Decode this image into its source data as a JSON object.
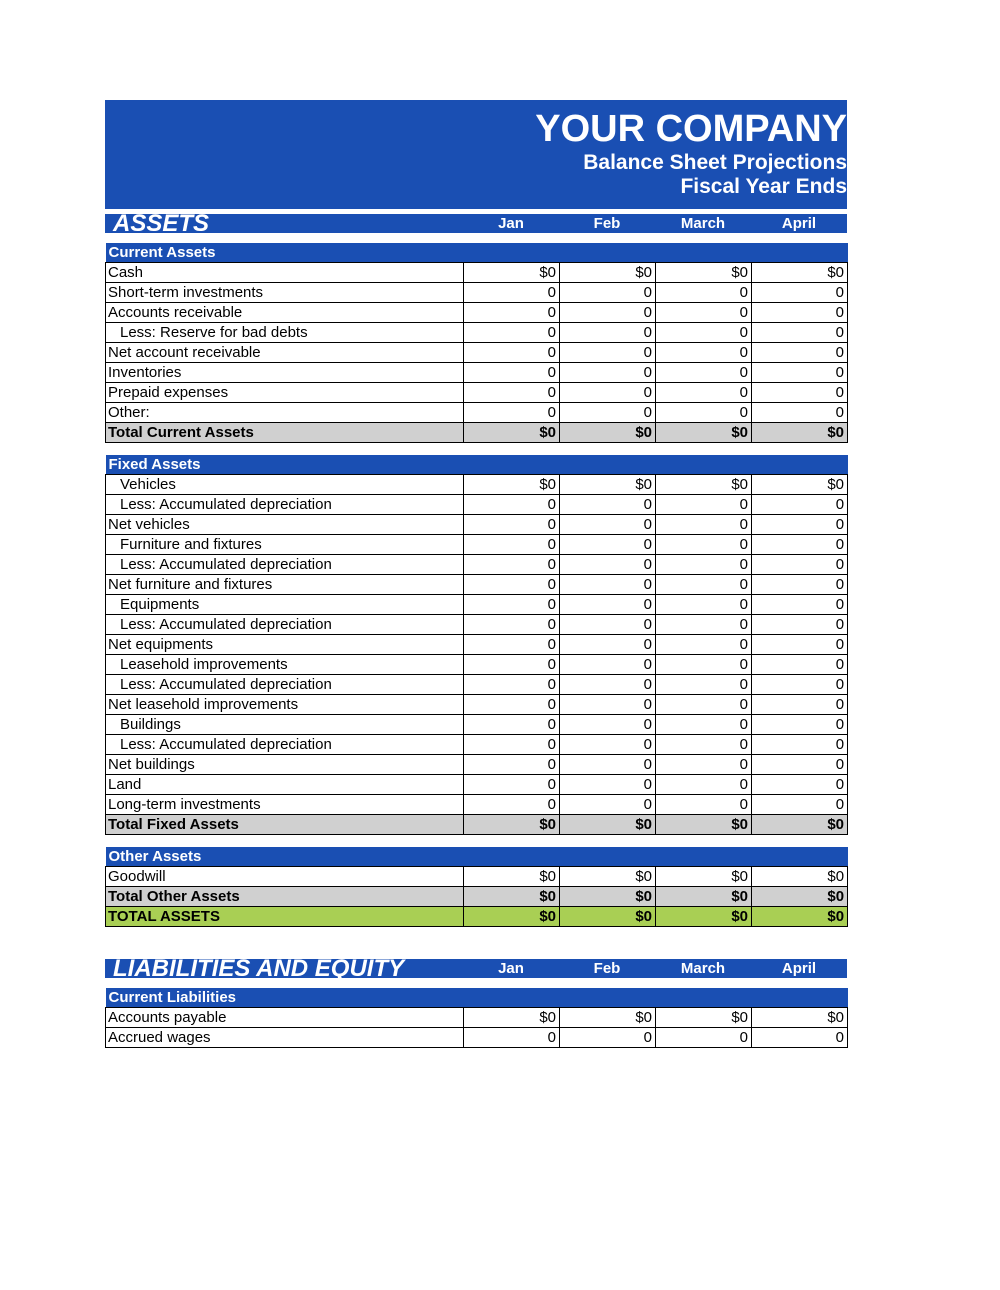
{
  "header": {
    "company": "YOUR COMPANY",
    "line1": "Balance Sheet Projections",
    "line2": "Fiscal Year Ends"
  },
  "months": [
    "Jan",
    "Feb",
    "March",
    "April"
  ],
  "assets": {
    "title": "ASSETS",
    "current": {
      "title": "Current Assets",
      "rows": [
        {
          "label": "Cash",
          "indent": 0,
          "v": [
            "$0",
            "$0",
            "$0",
            "$0"
          ]
        },
        {
          "label": "Short-term investments",
          "indent": 0,
          "v": [
            "0",
            "0",
            "0",
            "0"
          ]
        },
        {
          "label": "Accounts receivable",
          "indent": 0,
          "v": [
            "0",
            "0",
            "0",
            "0"
          ]
        },
        {
          "label": "Less: Reserve for bad debts",
          "indent": 1,
          "v": [
            "0",
            "0",
            "0",
            "0"
          ]
        },
        {
          "label": "Net account receivable",
          "indent": 0,
          "v": [
            "0",
            "0",
            "0",
            "0"
          ]
        },
        {
          "label": "Inventories",
          "indent": 0,
          "v": [
            "0",
            "0",
            "0",
            "0"
          ]
        },
        {
          "label": "Prepaid expenses",
          "indent": 0,
          "v": [
            "0",
            "0",
            "0",
            "0"
          ]
        },
        {
          "label": "Other:",
          "indent": 0,
          "v": [
            "0",
            "0",
            "0",
            "0"
          ],
          "lastopen": true
        }
      ],
      "total": {
        "label": "Total Current Assets",
        "v": [
          "$0",
          "$0",
          "$0",
          "$0"
        ]
      }
    },
    "fixed": {
      "title": "Fixed Assets",
      "rows": [
        {
          "label": "Vehicles",
          "indent": 1,
          "v": [
            "$0",
            "$0",
            "$0",
            "$0"
          ]
        },
        {
          "label": "Less: Accumulated depreciation",
          "indent": 1,
          "v": [
            "0",
            "0",
            "0",
            "0"
          ]
        },
        {
          "label": "Net vehicles",
          "indent": 0,
          "v": [
            "0",
            "0",
            "0",
            "0"
          ]
        },
        {
          "label": "Furniture and fixtures",
          "indent": 1,
          "v": [
            "0",
            "0",
            "0",
            "0"
          ]
        },
        {
          "label": "Less: Accumulated depreciation",
          "indent": 1,
          "v": [
            "0",
            "0",
            "0",
            "0"
          ]
        },
        {
          "label": "Net furniture and fixtures",
          "indent": 0,
          "v": [
            "0",
            "0",
            "0",
            "0"
          ]
        },
        {
          "label": "Equipments",
          "indent": 1,
          "v": [
            "0",
            "0",
            "0",
            "0"
          ]
        },
        {
          "label": "Less: Accumulated depreciation",
          "indent": 1,
          "v": [
            "0",
            "0",
            "0",
            "0"
          ]
        },
        {
          "label": "Net equipments",
          "indent": 0,
          "v": [
            "0",
            "0",
            "0",
            "0"
          ]
        },
        {
          "label": "Leasehold improvements",
          "indent": 1,
          "v": [
            "0",
            "0",
            "0",
            "0"
          ]
        },
        {
          "label": "Less: Accumulated depreciation",
          "indent": 1,
          "v": [
            "0",
            "0",
            "0",
            "0"
          ]
        },
        {
          "label": "Net leasehold improvements",
          "indent": 0,
          "v": [
            "0",
            "0",
            "0",
            "0"
          ]
        },
        {
          "label": "Buildings",
          "indent": 1,
          "v": [
            "0",
            "0",
            "0",
            "0"
          ]
        },
        {
          "label": "Less: Accumulated depreciation",
          "indent": 1,
          "v": [
            "0",
            "0",
            "0",
            "0"
          ]
        },
        {
          "label": "Net buildings",
          "indent": 0,
          "v": [
            "0",
            "0",
            "0",
            "0"
          ]
        },
        {
          "label": "Land",
          "indent": 0,
          "v": [
            "0",
            "0",
            "0",
            "0"
          ]
        },
        {
          "label": "Long-term investments",
          "indent": 0,
          "v": [
            "0",
            "0",
            "0",
            "0"
          ],
          "lastopen": true
        }
      ],
      "total": {
        "label": "Total Fixed Assets",
        "v": [
          "$0",
          "$0",
          "$0",
          "$0"
        ]
      }
    },
    "other": {
      "title": "Other Assets",
      "rows": [
        {
          "label": "Goodwill",
          "indent": 0,
          "v": [
            "$0",
            "$0",
            "$0",
            "$0"
          ]
        }
      ],
      "total": {
        "label": "Total Other Assets",
        "v": [
          "$0",
          "$0",
          "$0",
          "$0"
        ]
      }
    },
    "grand": {
      "label": "TOTAL ASSETS",
      "v": [
        "$0",
        "$0",
        "$0",
        "$0"
      ]
    }
  },
  "liab": {
    "title": "LIABILITIES AND EQUITY",
    "current": {
      "title": "Current Liabilities",
      "rows": [
        {
          "label": "Accounts payable",
          "indent": 0,
          "v": [
            "$0",
            "$0",
            "$0",
            "$0"
          ]
        },
        {
          "label": "Accrued wages",
          "indent": 0,
          "v": [
            "0",
            "0",
            "0",
            "0"
          ]
        }
      ]
    }
  }
}
